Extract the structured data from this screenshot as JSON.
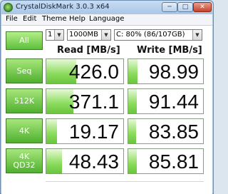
{
  "window": {
    "title": "CrystalDiskMark 3.0.3 x64",
    "minimize_glyph": "─",
    "maximize_glyph": "□",
    "close_glyph": "✕"
  },
  "menu": {
    "items": [
      {
        "label": "File"
      },
      {
        "label": "Edit"
      },
      {
        "label": "Theme"
      },
      {
        "label": "Help"
      },
      {
        "label": "Language"
      }
    ]
  },
  "controls": {
    "all_label": "All",
    "test_count": "1",
    "test_size": "1000MB",
    "drive": "C: 80% (86/107GB)"
  },
  "headers": {
    "read": "Read [MB/s]",
    "write": "Write [MB/s]"
  },
  "rows": [
    {
      "label": "Seq",
      "label2": "",
      "read": "426.0",
      "write": "98.99",
      "read_fill": 0.39,
      "write_fill": 0.12
    },
    {
      "label": "512K",
      "label2": "",
      "read": "371.1",
      "write": "91.44",
      "read_fill": 0.35,
      "write_fill": 0.11
    },
    {
      "label": "4K",
      "label2": "",
      "read": "19.17",
      "write": "83.85",
      "read_fill": 0.14,
      "write_fill": 0.1
    },
    {
      "label": "4K",
      "label2": "QD32",
      "read": "48.43",
      "write": "85.81",
      "read_fill": 0.2,
      "write_fill": 0.11
    }
  ]
}
